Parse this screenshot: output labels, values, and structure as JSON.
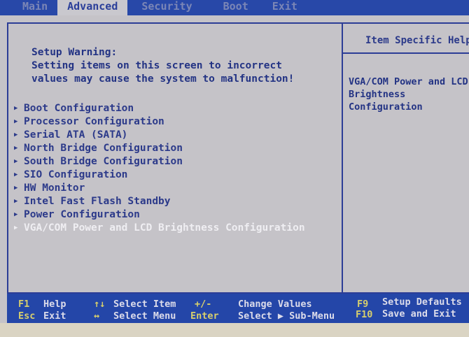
{
  "menubar": {
    "tabs": [
      {
        "label": "Main",
        "active": false
      },
      {
        "label": "Advanced",
        "active": true
      },
      {
        "label": "Security",
        "active": false
      },
      {
        "label": "Boot",
        "active": false
      },
      {
        "label": "Exit",
        "active": false
      }
    ]
  },
  "warning": {
    "title": "Setup Warning:",
    "line1": "Setting items on this screen to incorrect",
    "line2": "values may cause the system to malfunction!"
  },
  "items": [
    {
      "label": "Boot Configuration",
      "icon": "triangle-right-icon"
    },
    {
      "label": "Processor Configuration",
      "icon": "triangle-right-icon"
    },
    {
      "label": "Serial ATA (SATA)",
      "icon": "triangle-right-icon"
    },
    {
      "label": "North Bridge Configuration",
      "icon": "triangle-right-icon"
    },
    {
      "label": "South Bridge Configuration",
      "icon": "triangle-right-icon"
    },
    {
      "label": "SIO Configuration",
      "icon": "triangle-right-icon"
    },
    {
      "label": "HW Monitor",
      "icon": "triangle-right-icon"
    },
    {
      "label": "Intel Fast Flash Standby",
      "icon": "triangle-right-icon"
    },
    {
      "label": "Power Configuration",
      "icon": "triangle-right-icon"
    },
    {
      "label": "VGA/COM Power and LCD Brightness Configuration",
      "icon": "triangle-right-icon",
      "selected": true
    }
  ],
  "help": {
    "title": "Item Specific Help",
    "text": "VGA/COM Power and LCD\nBrightness\nConfiguration"
  },
  "footer": {
    "f1_key": "F1",
    "f1_label": "Help",
    "updown_key": "↑↓",
    "updown_label": "Select Item",
    "plusminus_key": "+/-",
    "plusminus_label": "Change Values",
    "f9_key": "F9",
    "f9_label": "Setup Defaults",
    "esc_key": "Esc",
    "esc_label": "Exit",
    "leftright_key": "↔",
    "leftright_label": "Select Menu",
    "enter_key": "Enter",
    "enter_label": "Select ▶ Sub-Menu",
    "f10_key": "F10",
    "f10_label": "Save and Exit"
  },
  "colors": {
    "menubar_bg": "#2848a8",
    "screen_bg": "#c5c3c8",
    "text_blue": "#2c3a8a",
    "footer_key": "#d8cf6c",
    "footer_text": "#dcdcea",
    "selected_text": "#efeef2"
  }
}
